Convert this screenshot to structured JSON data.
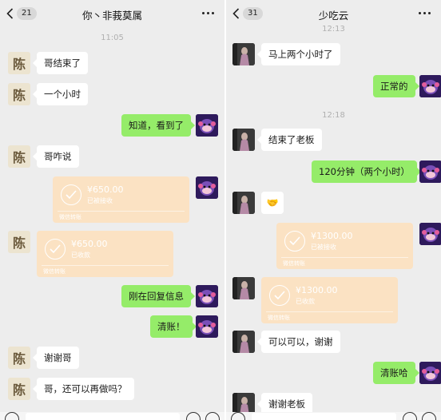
{
  "left": {
    "header": {
      "unread": "21",
      "title": "你丶非莪莫属"
    },
    "time_1": "11:05",
    "messages": [
      {
        "text": "哥结束了"
      },
      {
        "text": "一个小时"
      },
      {
        "text": "知道，看到了"
      },
      {
        "text": "哥咋说"
      },
      {
        "text": "刚在回复信息"
      },
      {
        "text": "清账！"
      },
      {
        "text": "谢谢哥"
      },
      {
        "text": "哥，还可以再做吗？"
      }
    ],
    "transfer_sent": {
      "amount": "¥650.00",
      "status": "已被接收",
      "footer": "微信转账"
    },
    "transfer_recv": {
      "amount": "¥650.00",
      "status": "已收款",
      "footer": "微信转账"
    },
    "avatar_char": "陈"
  },
  "right": {
    "header": {
      "unread": "31",
      "title": "少吃云"
    },
    "time_1": "12:13",
    "time_2": "12:18",
    "messages": [
      {
        "text": "马上两个小时了"
      },
      {
        "text": "正常的"
      },
      {
        "text": "结束了老板"
      },
      {
        "text": "120分钟（两个小时）"
      },
      {
        "text": "可以可以，谢谢"
      },
      {
        "text": "清账哈"
      },
      {
        "text": "谢谢老板"
      }
    ],
    "emoji": "🤝",
    "transfer_sent": {
      "amount": "¥1300.00",
      "status": "已被接收",
      "footer": "微信转账"
    },
    "transfer_recv": {
      "amount": "¥1300.00",
      "status": "已收款",
      "footer": "微信转账"
    }
  },
  "icons": {
    "back": "chevron-left-icon",
    "more": "more-dots-icon",
    "check": "check-circle-icon",
    "voice": "voice-icon",
    "emoji": "emoji-icon",
    "plus": "plus-icon"
  },
  "colors": {
    "background": "#ededed",
    "outgoing_bubble": "#95ec69",
    "incoming_bubble": "#ffffff",
    "transfer_card": "#fbe2c3",
    "timestamp": "#b0b0b0"
  }
}
